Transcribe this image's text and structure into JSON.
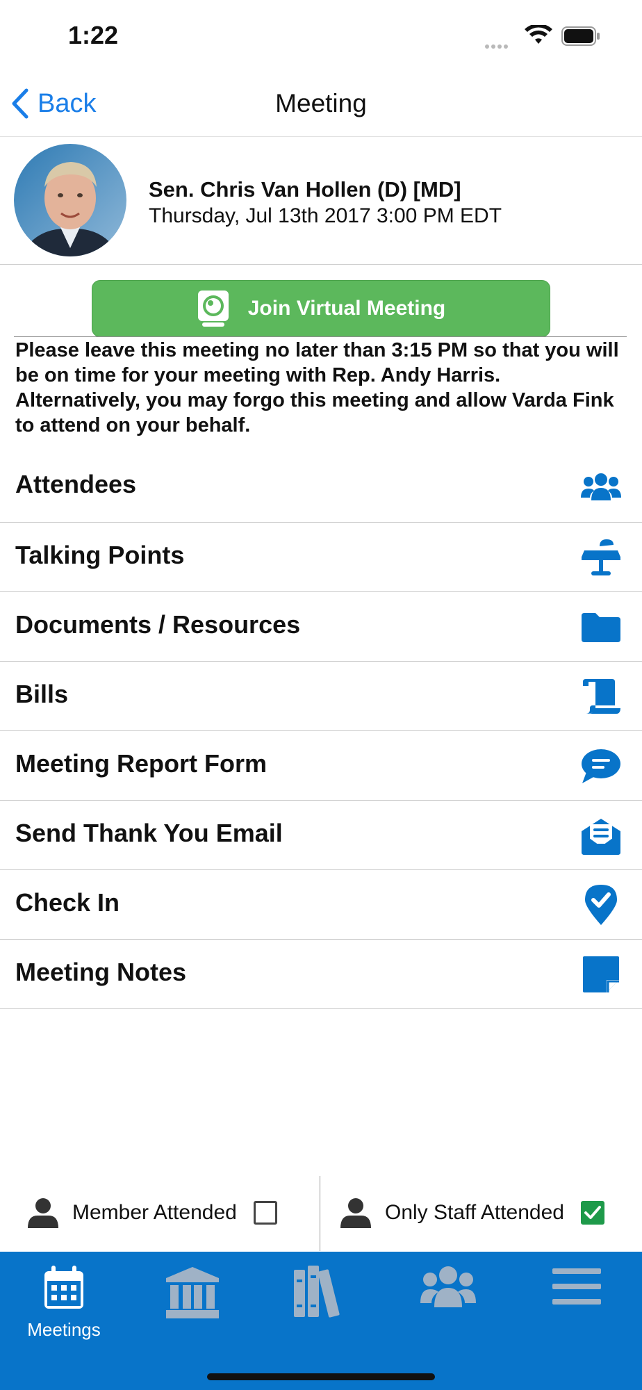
{
  "status_bar": {
    "time": "1:22"
  },
  "nav": {
    "back_label": "Back",
    "title": "Meeting"
  },
  "member": {
    "name": "Sen. Chris Van Hollen (D) [MD]",
    "datetime": "Thursday, Jul 13th 2017 3:00 PM EDT"
  },
  "join_button": {
    "label": "Join Virtual Meeting"
  },
  "notice": "Please leave this meeting no later than 3:15 PM so that you will be on time for your meeting with Rep. Andy Harris. Alternatively, you may forgo this meeting and allow Varda Fink to attend on your behalf.",
  "menu": {
    "items": [
      {
        "label": "Attendees",
        "icon": "users-icon"
      },
      {
        "label": "Talking Points",
        "icon": "podium-icon"
      },
      {
        "label": "Documents / Resources",
        "icon": "folder-icon"
      },
      {
        "label": "Bills",
        "icon": "scroll-icon"
      },
      {
        "label": "Meeting Report Form",
        "icon": "chat-icon"
      },
      {
        "label": "Send Thank You Email",
        "icon": "envelope-open-icon"
      },
      {
        "label": "Check In",
        "icon": "map-marker-check-icon"
      },
      {
        "label": "Meeting Notes",
        "icon": "sticky-note-icon"
      }
    ]
  },
  "attendance": {
    "member_label": "Member Attended",
    "member_checked": false,
    "staff_label": "Only Staff Attended",
    "staff_checked": true
  },
  "tabbar": {
    "tabs": [
      {
        "label": "Meetings",
        "icon": "calendar-icon",
        "active": true
      },
      {
        "label": "",
        "icon": "capitol-icon",
        "active": false
      },
      {
        "label": "",
        "icon": "books-icon",
        "active": false
      },
      {
        "label": "",
        "icon": "users-icon",
        "active": false
      },
      {
        "label": "",
        "icon": "menu-icon",
        "active": false
      }
    ]
  },
  "colors": {
    "accent": "#0874c9",
    "link": "#1a7ee8",
    "join_green": "#5cb85c",
    "check_green": "#1e9a4a"
  }
}
